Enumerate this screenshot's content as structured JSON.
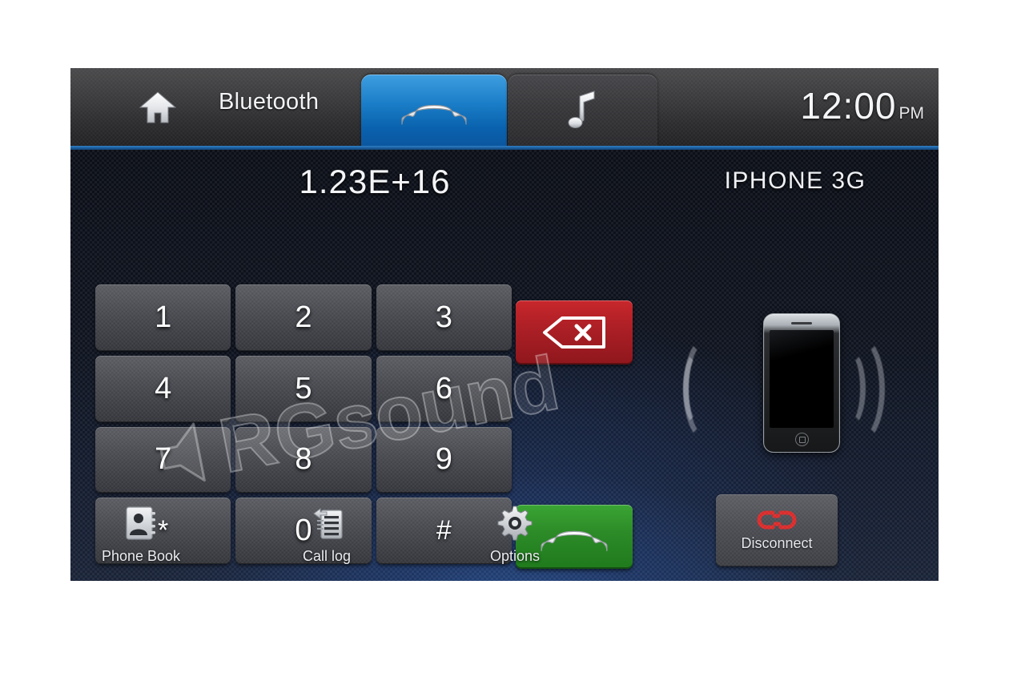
{
  "header": {
    "home_icon": "home-icon",
    "title": "Bluetooth",
    "tabs": [
      {
        "label": "",
        "icon": "phone-handset-icon",
        "active": true
      },
      {
        "label": "",
        "icon": "music-note-icon",
        "active": false
      }
    ],
    "clock_time": "12:00",
    "clock_ampm": "PM",
    "accent_color": "#1b5e9e"
  },
  "main": {
    "dial_number": "1.23E+16",
    "device_name": "IPHONE 3G",
    "keypad": [
      {
        "label": "1"
      },
      {
        "label": "2"
      },
      {
        "label": "3"
      },
      {
        "label": "4"
      },
      {
        "label": "5"
      },
      {
        "label": "6"
      },
      {
        "label": "7"
      },
      {
        "label": "8"
      },
      {
        "label": "9"
      },
      {
        "label": "*"
      },
      {
        "label": "0"
      },
      {
        "label": "#"
      }
    ],
    "delete_button": {
      "icon": "backspace-delete-icon",
      "color": "#ab1f25"
    },
    "call_button": {
      "icon": "phone-handset-icon",
      "color": "#2c8a27"
    },
    "disconnect_button": {
      "label": "Disconnect",
      "icon": "broken-chain-icon",
      "icon_color": "#d92b2b"
    },
    "phone_illustration": {
      "icon": "iphone-device-icon",
      "waves": "bluetooth-signal-waves"
    }
  },
  "bottombar": {
    "items": [
      {
        "label": "Phone Book",
        "icon": "contact-book-icon"
      },
      {
        "label": "Call log",
        "icon": "call-log-list-icon"
      },
      {
        "label": "Options",
        "icon": "gear-icon"
      }
    ]
  },
  "watermark": {
    "brand_prefix": "RG",
    "brand_suffix": "sound",
    "icon": "speaker-icon"
  }
}
